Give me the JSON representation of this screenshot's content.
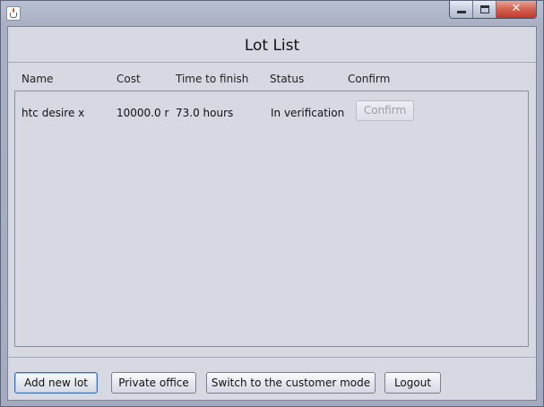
{
  "window": {
    "title": "",
    "app_icon": "java-cup-icon",
    "controls": {
      "minimize_icon": "minimize-icon",
      "maximize_icon": "maximize-icon",
      "close_icon": "close-icon",
      "close_glyph": "✕"
    }
  },
  "header": {
    "title": "Lot List"
  },
  "columns": {
    "name": "Name",
    "cost": "Cost",
    "time": "Time to finish",
    "status": "Status",
    "confirm": "Confirm"
  },
  "lots": [
    {
      "name": "htc desire x",
      "cost": "10000.0 r",
      "time": "73.0 hours",
      "status": "In verification",
      "confirm_label": "Confirm",
      "confirm_enabled": false
    }
  ],
  "buttons": {
    "add_new_lot": "Add new lot",
    "private_office": "Private office",
    "switch_mode": "Switch to the customer mode",
    "logout": "Logout"
  },
  "colors": {
    "background": "#d6d9e2",
    "title_bar": "#a9b0c4",
    "close_button": "#c0392b",
    "focus_border": "#3c6fb4"
  }
}
